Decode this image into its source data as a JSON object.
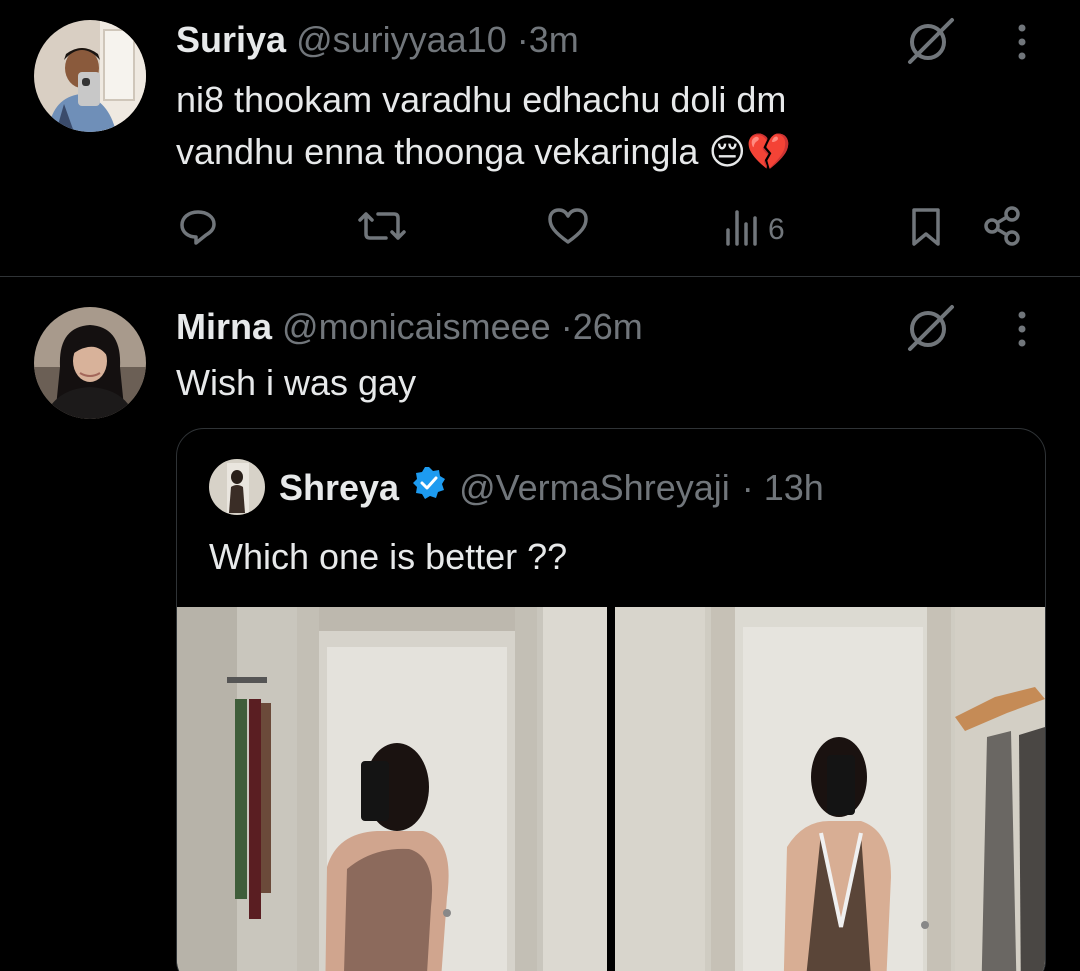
{
  "tweets": [
    {
      "name": "Suriya",
      "handle": "@suriyyaa10",
      "separator": "·",
      "time": "3m",
      "text_line1": "ni8 thookam varadhu edhachu doli dm",
      "text_line2": "vandhu enna thoonga vekaringla",
      "text_emoji": "😔💔",
      "views": "6"
    },
    {
      "name": "Mirna",
      "handle": "@monicaismeee",
      "separator": "·",
      "time": "26m",
      "text": "Wish i was gay"
    }
  ],
  "quoted": {
    "name": "Shreya",
    "handle": "@VermaShreyaji",
    "separator": "·",
    "time": "13h",
    "text": "Which one is better ??",
    "verified": true,
    "verified_color": "#1d9bf0"
  },
  "colors": {
    "background": "#000000",
    "primary_text": "#e7e9ea",
    "secondary_text": "#71767b",
    "border": "#2f3336"
  },
  "icons": [
    "grok-icon",
    "more-icon",
    "reply-icon",
    "retweet-icon",
    "like-icon",
    "views-icon",
    "bookmark-icon",
    "share-icon",
    "verified-icon"
  ]
}
